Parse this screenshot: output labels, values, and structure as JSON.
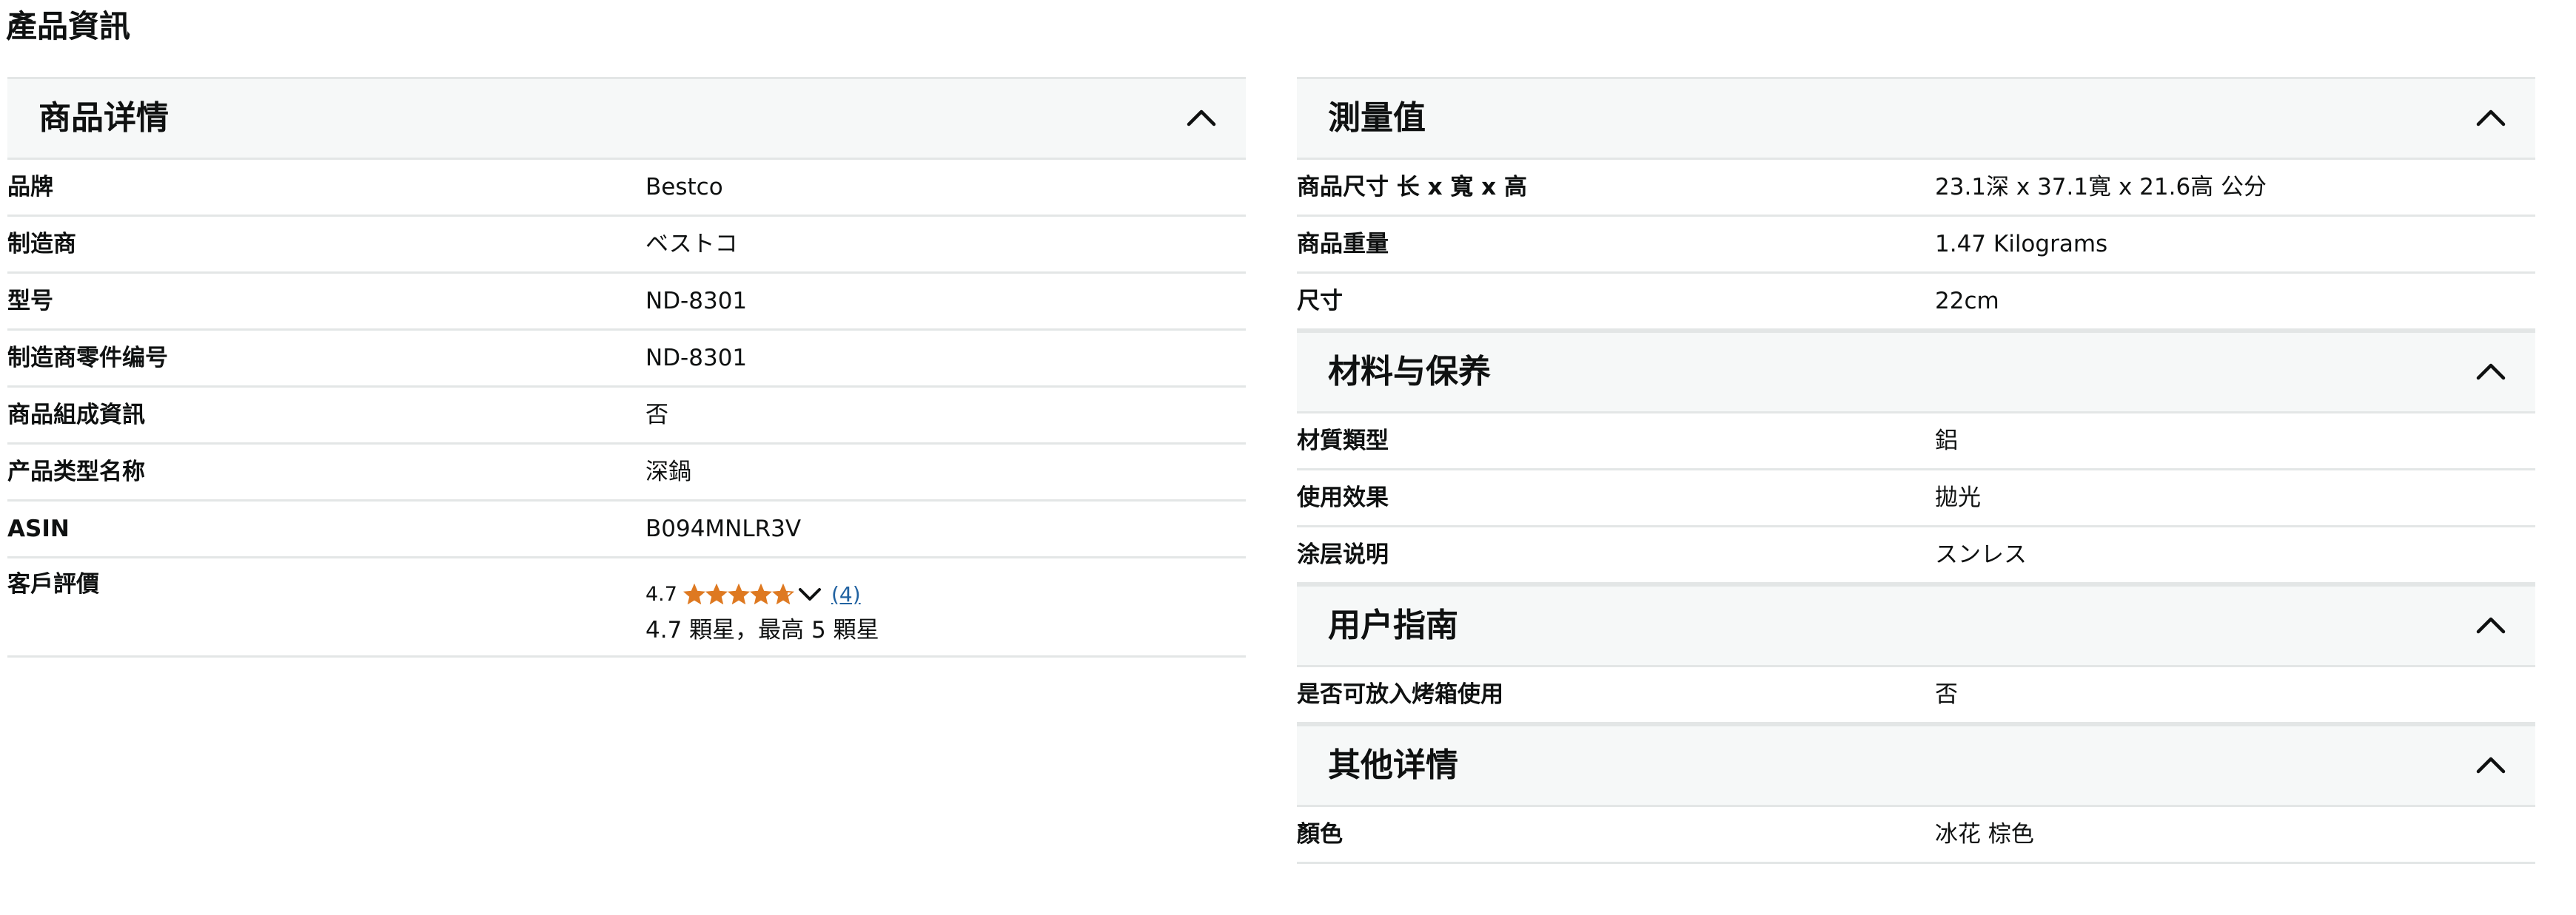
{
  "page_title": "產品資訊",
  "left_sections": [
    {
      "title": "商品详情",
      "rows": [
        {
          "label": "品牌",
          "value": "Bestco"
        },
        {
          "label": "制造商",
          "value": "ベストコ"
        },
        {
          "label": "型号",
          "value": "ND-8301"
        },
        {
          "label": "制造商零件编号",
          "value": "ND-8301"
        },
        {
          "label": "商品組成資訊",
          "value": "否"
        },
        {
          "label": "产品类型名称",
          "value": "深鍋"
        },
        {
          "label": "ASIN",
          "value": "B094MNLR3V"
        }
      ],
      "rating": {
        "label": "客戶評價",
        "score": "4.7",
        "stars_value": 4.7,
        "stars_max": 5,
        "count": "(4)",
        "text": "4.7 顆星，最高 5 顆星",
        "star_color": "#de7921"
      }
    }
  ],
  "right_sections": [
    {
      "title": "測量值",
      "rows": [
        {
          "label": "商品尺寸 长 x 寬 x 高",
          "value": "23.1深 x 37.1寛 x 21.6高 公分"
        },
        {
          "label": "商品重量",
          "value": "1.47 Kilograms"
        },
        {
          "label": "尺寸",
          "value": "22cm"
        }
      ]
    },
    {
      "title": "材料与保养",
      "rows": [
        {
          "label": "材質類型",
          "value": "鋁"
        },
        {
          "label": "使用效果",
          "value": "拋光"
        },
        {
          "label": "涂层说明",
          "value": "スンレス"
        }
      ]
    },
    {
      "title": "用户指南",
      "rows": [
        {
          "label": "是否可放入烤箱使用",
          "value": "否"
        }
      ]
    },
    {
      "title": "其他详情",
      "rows": [
        {
          "label": "顏色",
          "value": "冰花 棕色"
        }
      ]
    }
  ],
  "icons": {
    "collapse": "chevron-up-icon",
    "rating_dropdown": "chevron-down-icon",
    "star": "star-icon"
  },
  "colors": {
    "header_bg": "#f6f8f8",
    "divider": "#e3e6e6",
    "link": "#2162a1",
    "text": "#0f1111"
  }
}
